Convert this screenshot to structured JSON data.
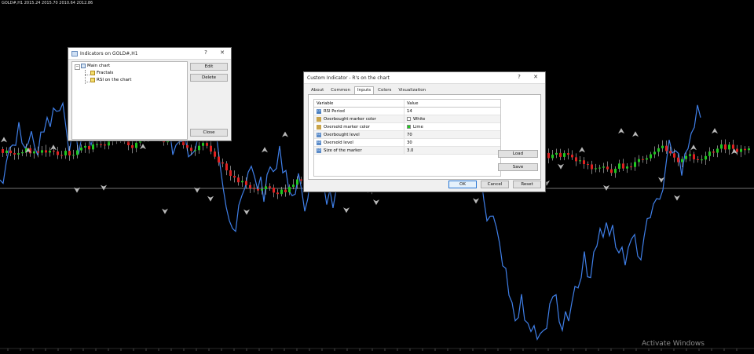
{
  "chart": {
    "header": "GOLD#,H1  2015.24 2015.70 2010.64 2012.86"
  },
  "indicators_dialog": {
    "title": "Indicators on GOLD#,H1",
    "help": "?",
    "close": "✕",
    "tree": {
      "root": "Main chart",
      "children": [
        "Fractals",
        "RSI on the chart"
      ]
    },
    "buttons": {
      "edit": "Edit",
      "delete": "Delete",
      "close": "Close"
    }
  },
  "custom_dialog": {
    "title": "Custom Indicator - R's on the chart",
    "help": "?",
    "close": "✕",
    "tabs": [
      "About",
      "Common",
      "Inputs",
      "Colors",
      "Visualization"
    ],
    "active_tab": "Inputs",
    "grid": {
      "headers": [
        "Variable",
        "Value"
      ],
      "rows": [
        {
          "icon": "123",
          "variable": "RSI Period",
          "value": "14",
          "type": "int"
        },
        {
          "icon": "",
          "variable": "Overbought marker color",
          "value": "White",
          "type": "color",
          "swatch": "#ffffff"
        },
        {
          "icon": "",
          "variable": "Oversold marker color",
          "value": "Lime",
          "type": "color",
          "swatch": "#22cc22"
        },
        {
          "icon": "12",
          "variable": "Overbought level",
          "value": "70",
          "type": "double"
        },
        {
          "icon": "12",
          "variable": "Oversold level",
          "value": "30",
          "type": "double"
        },
        {
          "icon": "12",
          "variable": "Size of the marker",
          "value": "3.0",
          "type": "double"
        }
      ]
    },
    "buttons": {
      "load": "Load",
      "save": "Save",
      "ok": "OK",
      "cancel": "Cancel",
      "reset": "Reset"
    }
  },
  "watermark": "Activate Windows",
  "colors": {
    "background": "#000000",
    "bull_candle": "#1fc81f",
    "bear_candle": "#e02020",
    "rsi_line": "#3f7fe8",
    "level_line": "#9a9a9a",
    "fractal": "#b9b9b9"
  }
}
